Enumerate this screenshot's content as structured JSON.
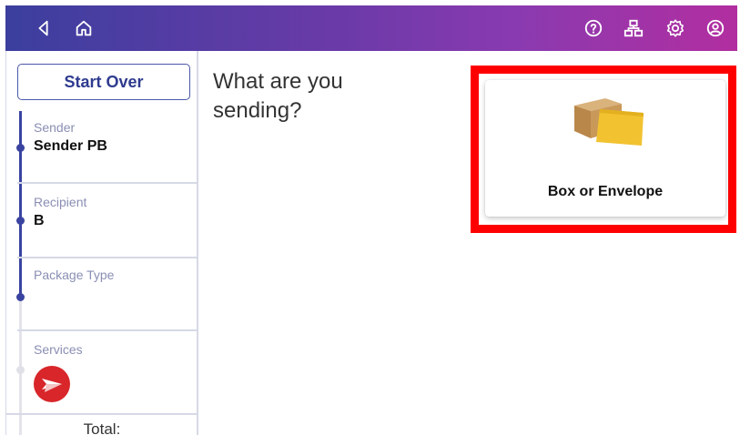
{
  "topbar": {
    "icons": [
      "back-icon",
      "home-icon",
      "help-icon",
      "network-icon",
      "settings-icon",
      "account-icon"
    ],
    "gradient": [
      "#3b3f9e",
      "#b22ea0"
    ]
  },
  "sidebar": {
    "start_over": "Start Over",
    "steps": [
      {
        "label": "Sender",
        "value": "Sender PB"
      },
      {
        "label": "Recipient",
        "value": "B"
      },
      {
        "label": "Package Type",
        "value": ""
      },
      {
        "label": "Services",
        "value": ""
      }
    ],
    "total_label": "Total:"
  },
  "main": {
    "question": "What are you sending?",
    "option_label": "Box or Envelope",
    "highlight_color": "#ff0000"
  }
}
